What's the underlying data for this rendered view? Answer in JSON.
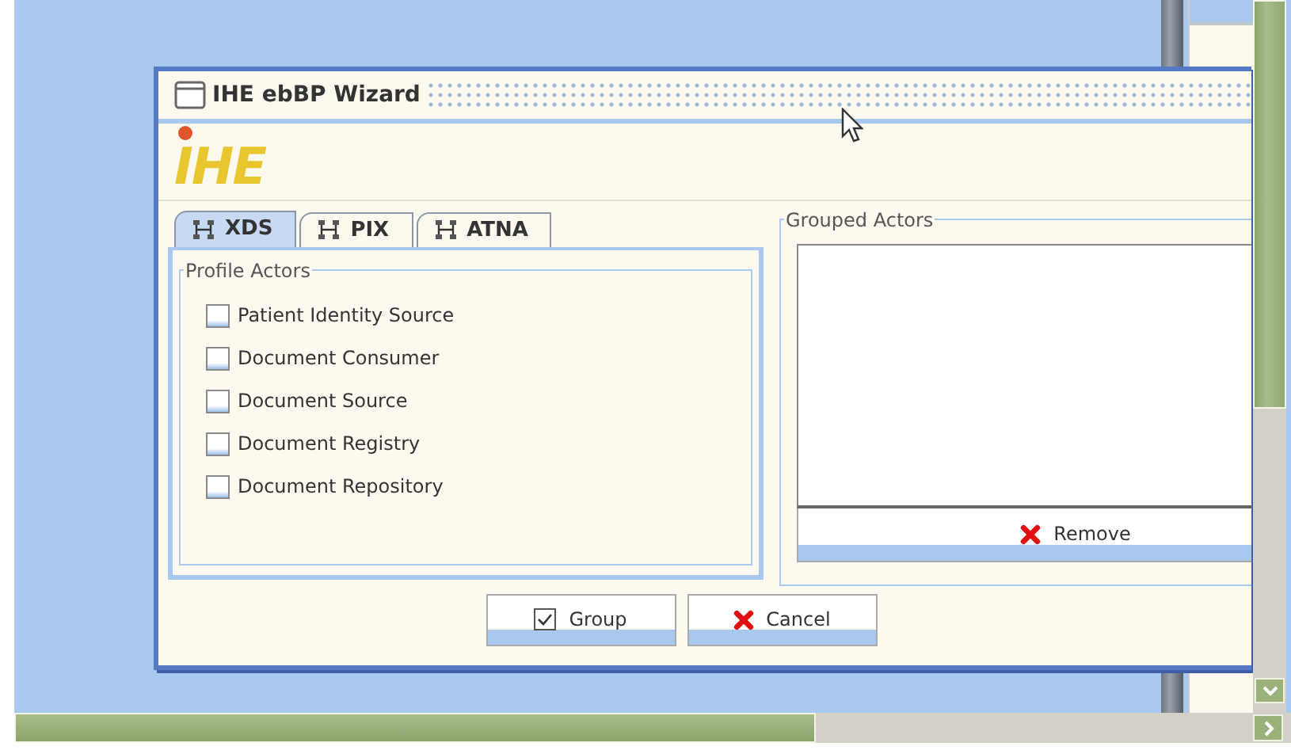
{
  "window": {
    "title": "IHE ebBP Wizard"
  },
  "logo": {
    "text": "IHE"
  },
  "tabs": [
    {
      "label": "XDS",
      "selected": true
    },
    {
      "label": "PIX",
      "selected": false
    },
    {
      "label": "ATNA",
      "selected": false
    }
  ],
  "profile_actors": {
    "title": "Profile Actors",
    "items": [
      {
        "label": "Patient Identity Source",
        "checked": false
      },
      {
        "label": "Document Consumer",
        "checked": false
      },
      {
        "label": "Document Source",
        "checked": false
      },
      {
        "label": "Document Registry",
        "checked": false
      },
      {
        "label": "Document Repository",
        "checked": false
      }
    ]
  },
  "grouped_actors": {
    "title": "Grouped Actors",
    "remove_button": "Remove"
  },
  "buttons": [
    {
      "label": "Group",
      "kind": "confirm"
    },
    {
      "label": "Cancel",
      "kind": "cancel"
    }
  ]
}
